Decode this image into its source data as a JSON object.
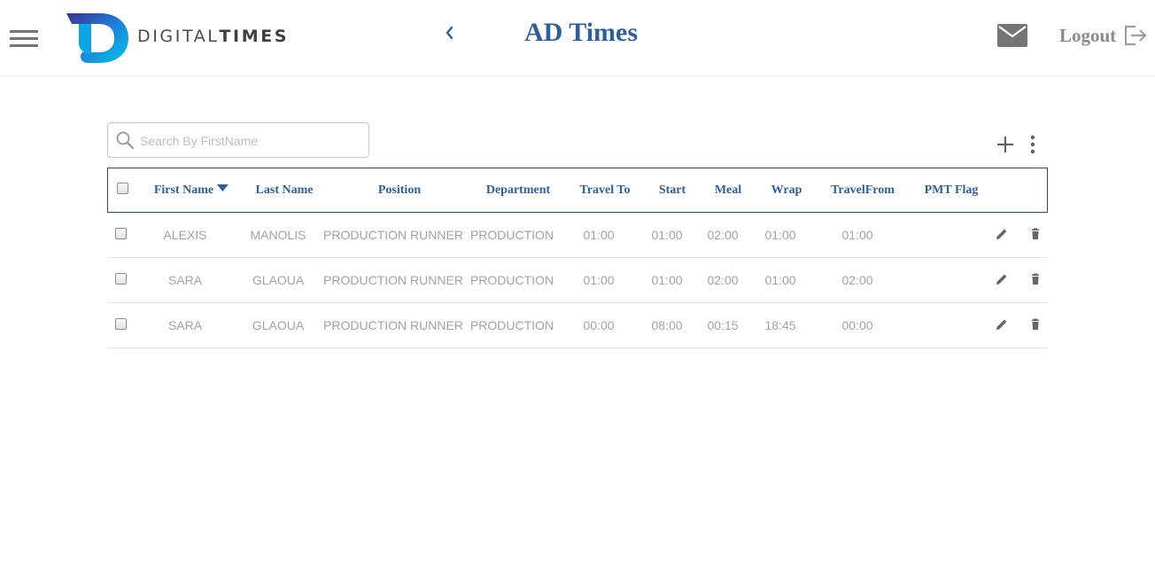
{
  "header": {
    "logo_text_light": "DIGITAL",
    "logo_text_bold": "TIMES",
    "title": "AD Times",
    "logout_label": "Logout",
    "icons": {
      "menu": "hamburger-icon",
      "back": "chevron-left-icon",
      "mail": "mail-icon",
      "logout": "logout-icon"
    }
  },
  "toolbar": {
    "search_placeholder": "Search By FirstName",
    "search_value": "",
    "add_icon": "plus-icon",
    "more_icon": "more-vertical-icon"
  },
  "table": {
    "columns": {
      "first_name": "First Name",
      "last_name": "Last Name",
      "position": "Position",
      "department": "Department",
      "travel_to": "Travel To",
      "start": "Start",
      "meal": "Meal",
      "wrap": "Wrap",
      "travel_from": "TravelFrom",
      "pmt_flag": "PMT Flag"
    },
    "sorted_column": "First Name",
    "sort_direction": "desc",
    "rows": [
      {
        "first_name": "ALEXIS",
        "last_name": "MANOLIS",
        "position": "PRODUCTION RUNNER",
        "department": "PRODUCTION",
        "travel_to": "01:00",
        "start": "01:00",
        "meal": "02:00",
        "wrap": "01:00",
        "travel_from": "01:00",
        "pmt_flag": ""
      },
      {
        "first_name": "SARA",
        "last_name": "GLAOUA",
        "position": "PRODUCTION RUNNER",
        "department": "PRODUCTION",
        "travel_to": "01:00",
        "start": "01:00",
        "meal": "02:00",
        "wrap": "01:00",
        "travel_from": "02:00",
        "pmt_flag": ""
      },
      {
        "first_name": "SARA",
        "last_name": "GLAOUA",
        "position": "PRODUCTION RUNNER",
        "department": "PRODUCTION",
        "travel_to": "00:00",
        "start": "08:00",
        "meal": "00:15",
        "wrap": "18:45",
        "travel_from": "00:00",
        "pmt_flag": ""
      }
    ],
    "row_actions": [
      "pencil-icon",
      "trash-icon"
    ]
  },
  "colors": {
    "title_blue": "#2e5f98",
    "header_border": "#2c4c6a",
    "cell_text": "#a2a2a2",
    "icon_gray": "#757575",
    "logo_gradient": [
      "#2f2f8f",
      "#00b7ea"
    ]
  }
}
